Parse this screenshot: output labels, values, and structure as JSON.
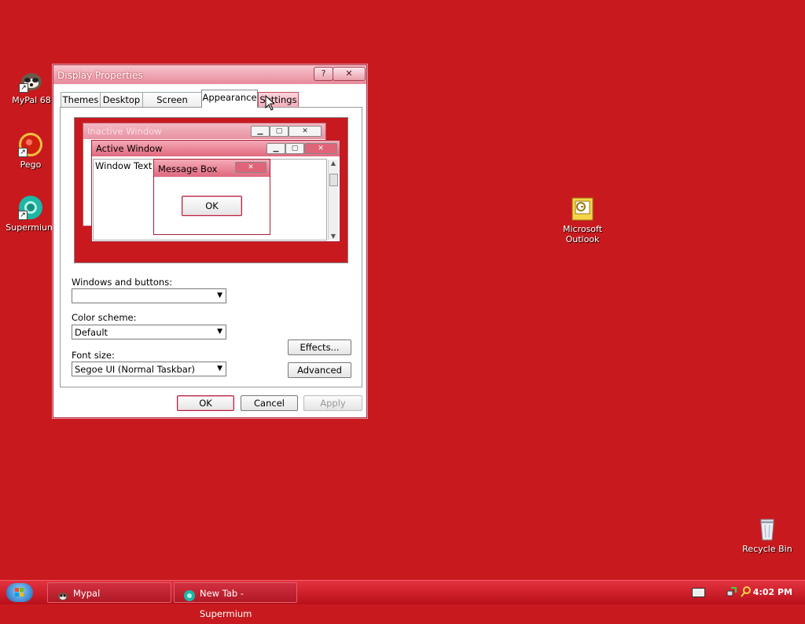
{
  "desktop": {
    "icons": [
      {
        "label": "MyPal 68",
        "icon": "raccoon-icon"
      },
      {
        "label": "Pego",
        "icon": "pego-icon"
      },
      {
        "label": "Supermium",
        "icon": "supermium-icon"
      },
      {
        "label": "Microsoft\nOutlook",
        "icon": "outlook-icon"
      },
      {
        "label": "Recycle Bin",
        "icon": "recycle-bin-icon"
      }
    ]
  },
  "dialog": {
    "title": "Display Properties",
    "help_label": "?",
    "close_label": "✕",
    "tabs": [
      {
        "label": "Themes"
      },
      {
        "label": "Desktop"
      },
      {
        "label": "Screen Saver"
      },
      {
        "label": "Appearance"
      },
      {
        "label": "Settings"
      }
    ],
    "active_tab": "Appearance",
    "preview": {
      "inactive_title": "Inactive Window",
      "active_title": "Active Window",
      "window_text": "Window Text",
      "message_title": "Message Box",
      "ok_label": "OK"
    },
    "windows_buttons": {
      "label": "Windows and buttons:",
      "value": ""
    },
    "color_scheme": {
      "label": "Color scheme:",
      "value": "Default"
    },
    "font_size": {
      "label": "Font size:",
      "value": "Segoe UI (Normal Taskbar)"
    },
    "effects_label": "Effects...",
    "advanced_label": "Advanced",
    "ok_label": "OK",
    "cancel_label": "Cancel",
    "apply_label": "Apply"
  },
  "taskbar": {
    "tasks": [
      {
        "label": "Mypal",
        "icon": "mypal-icon"
      },
      {
        "label": "New Tab - Supermium",
        "icon": "supermium-icon"
      }
    ],
    "clock": "4:02 PM"
  },
  "colors": {
    "desktop": "#c81a1e",
    "accent": "#e88a9a"
  }
}
